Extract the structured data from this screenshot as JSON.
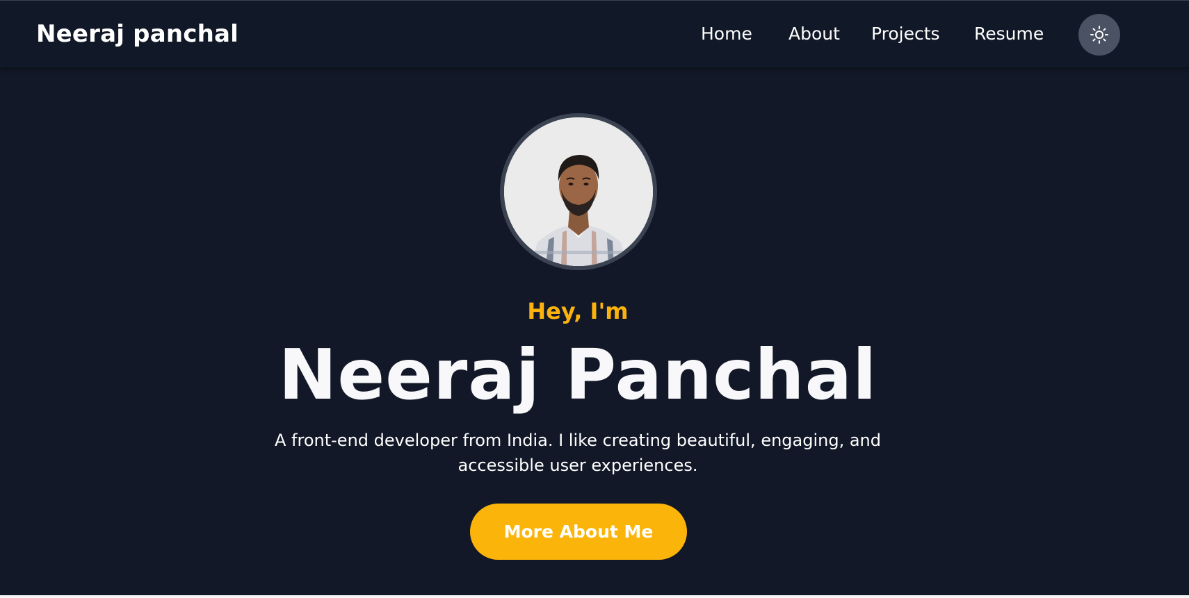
{
  "header": {
    "brand": "Neeraj panchal",
    "nav": [
      {
        "label": "Home"
      },
      {
        "label": "About"
      },
      {
        "label": "Projects"
      },
      {
        "label": "Resume"
      }
    ],
    "theme_toggle_icon": "sun-icon"
  },
  "hero": {
    "greeting": "Hey, I'm",
    "name": "Neeraj Panchal",
    "description": "A front-end developer from India. I like creating beautiful, engaging, and accessible user experiences.",
    "cta_label": "More About Me"
  },
  "colors": {
    "background": "#121827",
    "navbar": "#111827",
    "accent": "#fbb20e",
    "toggle_bg": "#4a5263"
  }
}
